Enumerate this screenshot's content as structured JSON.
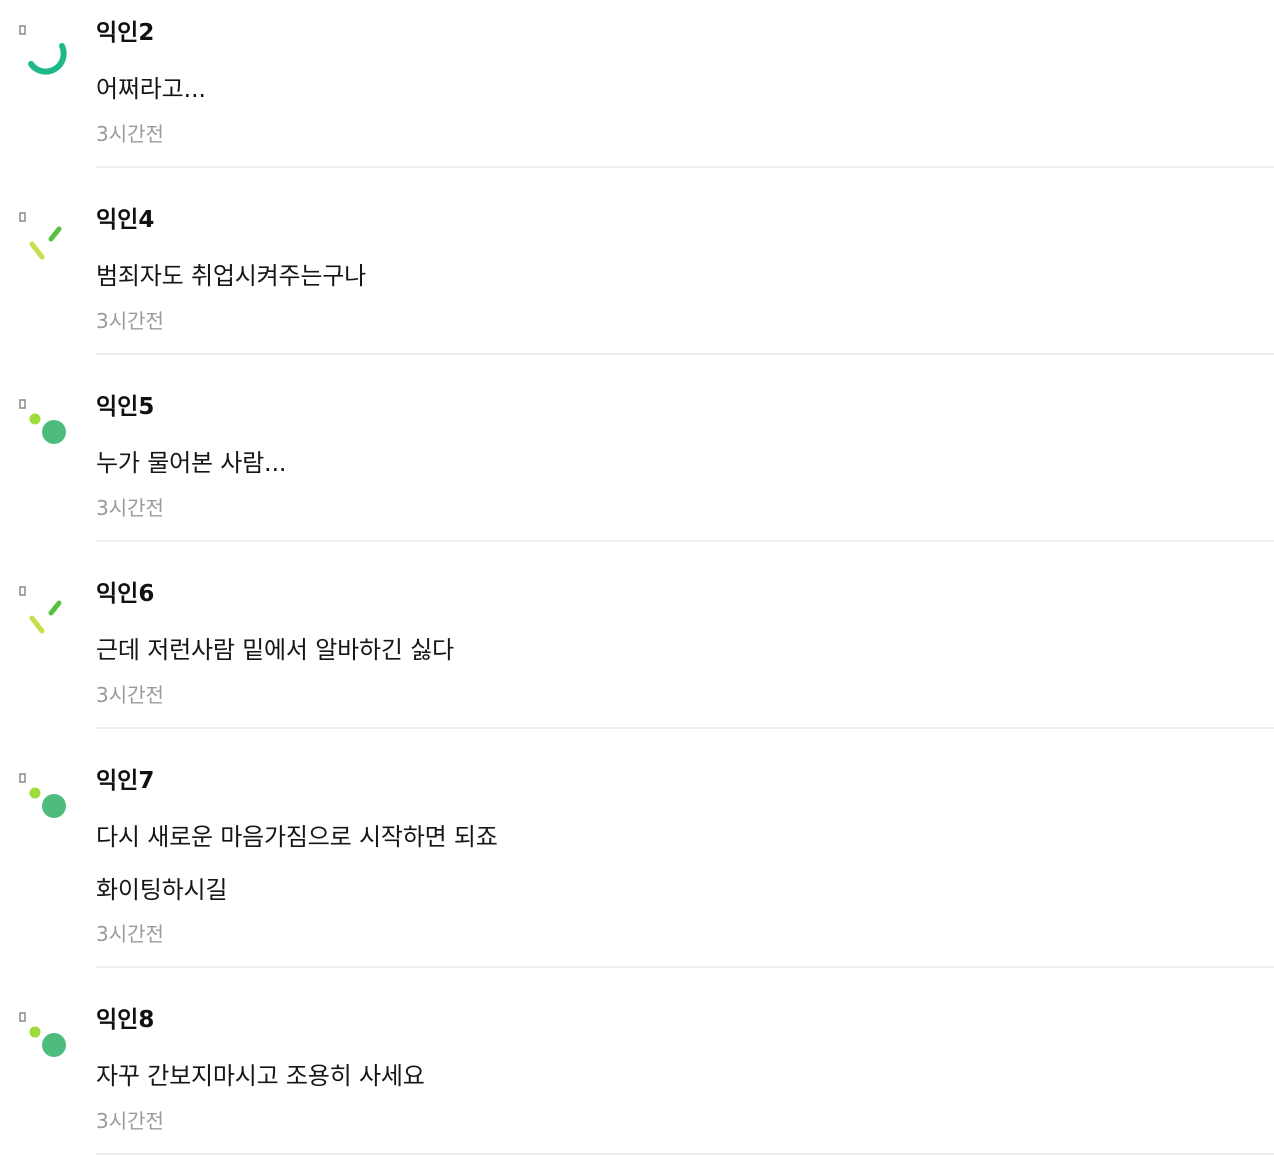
{
  "comments": [
    {
      "author": "익인2",
      "lines": [
        "어쩌라고..."
      ],
      "time": "3시간전",
      "avatar_icon": "arc-avatar-icon",
      "avatar_colors": [
        "#1db98a"
      ]
    },
    {
      "author": "익인4",
      "lines": [
        "범죄자도 취업시켜주는구나"
      ],
      "time": "3시간전",
      "avatar_icon": "slashes-avatar-icon",
      "avatar_colors": [
        "#c8de4b",
        "#56c241"
      ]
    },
    {
      "author": "익인5",
      "lines": [
        "누가 물어본 사람..."
      ],
      "time": "3시간전",
      "avatar_icon": "dots-avatar-icon",
      "avatar_colors": [
        "#9ddc3b",
        "#4ebc7c"
      ]
    },
    {
      "author": "익인6",
      "lines": [
        "근데 저런사람 밑에서 알바하긴 싫다"
      ],
      "time": "3시간전",
      "avatar_icon": "slashes-avatar-icon",
      "avatar_colors": [
        "#c8de4b",
        "#56c241"
      ]
    },
    {
      "author": "익인7",
      "lines": [
        "다시 새로운 마음가짐으로 시작하면 되죠",
        "화이팅하시길"
      ],
      "time": "3시간전",
      "avatar_icon": "dots-avatar-icon",
      "avatar_colors": [
        "#9ddc3b",
        "#4ebc7c"
      ]
    },
    {
      "author": "익인8",
      "lines": [
        "자꾸 간보지마시고 조용히 사세요"
      ],
      "time": "3시간전",
      "avatar_icon": "dots-avatar-icon",
      "avatar_colors": [
        "#9ddc3b",
        "#4ebc7c"
      ]
    }
  ]
}
